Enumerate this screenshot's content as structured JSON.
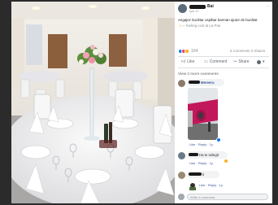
{
  "post": {
    "author": "Bai",
    "date": "Iyul 17",
    "text_line1": "Angajez bucătar ospătar barman ajutor de bucătar",
    "text_line2": "— feeling cool at La Prai",
    "reaction_count": "104",
    "comments_count": "5 Comments",
    "shares_count": "0 Shares"
  },
  "actions": {
    "like": "Like",
    "comment": "Comment",
    "share": "Share"
  },
  "view_previous": "View 2 more comments",
  "comments": [
    {
      "author_suffix": "Mereera",
      "actions": "Like · Reply · 1y"
    },
    {
      "text": "Ha te selegit",
      "actions": "Like · Reply · 1y"
    },
    {
      "author_suffix": "ti",
      "actions": "Like · Reply · 1y"
    }
  ],
  "input": {
    "placeholder": "Write a comment..."
  },
  "colors": {
    "like_blue": "#1877f2",
    "love_red": "#f33e58",
    "haha_yellow": "#f7b125",
    "plane_pink": "#c2185b"
  }
}
